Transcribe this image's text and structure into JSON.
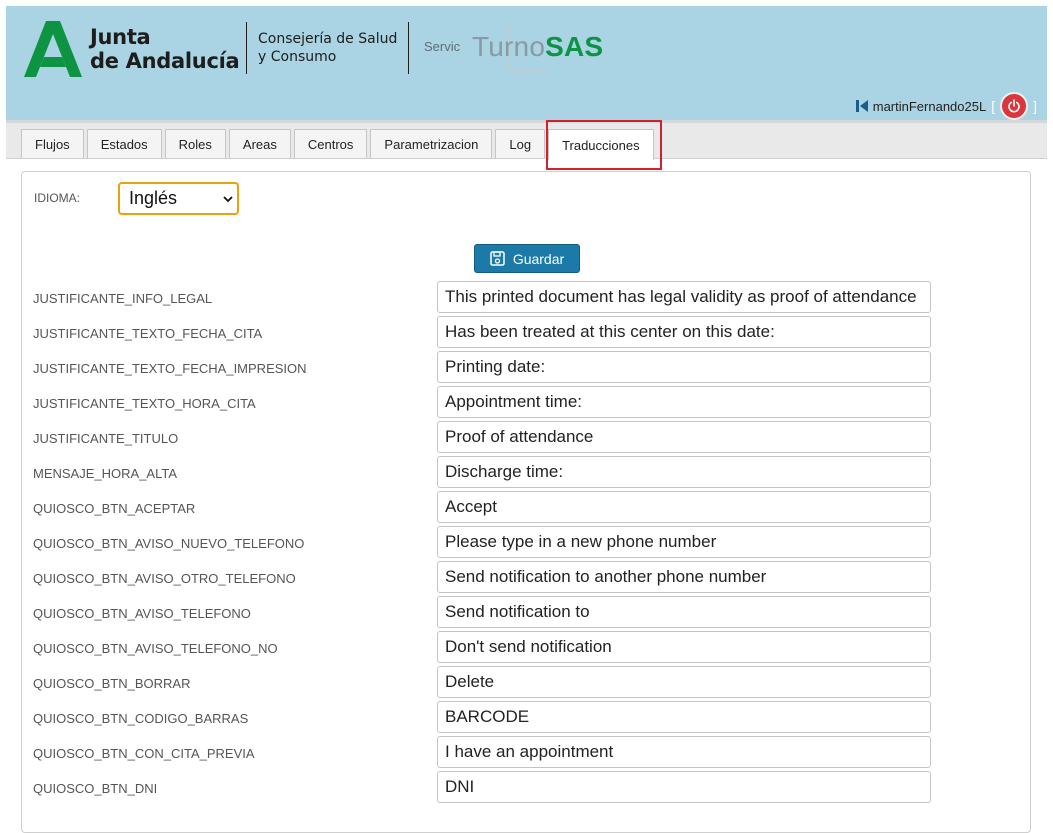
{
  "header": {
    "logo_line1": "Junta",
    "logo_line2": "de Andalucía",
    "consejeria_line1": "Consejería de Salud",
    "consejeria_line2": "y Consumo",
    "service_label": "Servic",
    "product_name_prefix": "Turno",
    "product_name_suffix": "SAS",
    "username": "martinFernando25L",
    "bracket_open": "[",
    "bracket_close": "]",
    "colors": {
      "header_bg": "#aad3e3",
      "brand_green": "#0c9443",
      "power_red": "#d9363e"
    }
  },
  "tabs": [
    {
      "label": "Flujos"
    },
    {
      "label": "Estados"
    },
    {
      "label": "Roles"
    },
    {
      "label": "Areas"
    },
    {
      "label": "Centros"
    },
    {
      "label": "Parametrizacion"
    },
    {
      "label": "Log"
    },
    {
      "label": "Traducciones",
      "active": true
    }
  ],
  "form": {
    "idioma_label": "IDIOMA:",
    "idioma_value": "Inglés",
    "save_label": "Guardar",
    "rows": [
      {
        "key": "JUSTIFICANTE_INFO_LEGAL",
        "value": "This printed document has legal validity as proof of attendance"
      },
      {
        "key": "JUSTIFICANTE_TEXTO_FECHA_CITA",
        "value": "Has been treated at this center on this date:"
      },
      {
        "key": "JUSTIFICANTE_TEXTO_FECHA_IMPRESION",
        "value": "Printing date:"
      },
      {
        "key": "JUSTIFICANTE_TEXTO_HORA_CITA",
        "value": "Appointment time:"
      },
      {
        "key": "JUSTIFICANTE_TITULO",
        "value": "Proof of attendance"
      },
      {
        "key": "MENSAJE_HORA_ALTA",
        "value": "Discharge time:"
      },
      {
        "key": "QUIOSCO_BTN_ACEPTAR",
        "value": "Accept"
      },
      {
        "key": "QUIOSCO_BTN_AVISO_NUEVO_TELEFONO",
        "value": "Please type in a new phone number"
      },
      {
        "key": "QUIOSCO_BTN_AVISO_OTRO_TELEFONO",
        "value": "Send notification to another phone number"
      },
      {
        "key": "QUIOSCO_BTN_AVISO_TELEFONO",
        "value": "Send notification to"
      },
      {
        "key": "QUIOSCO_BTN_AVISO_TELEFONO_NO",
        "value": "Don't send notification"
      },
      {
        "key": "QUIOSCO_BTN_BORRAR",
        "value": "Delete"
      },
      {
        "key": "QUIOSCO_BTN_CODIGO_BARRAS",
        "value": "BARCODE"
      },
      {
        "key": "QUIOSCO_BTN_CON_CITA_PREVIA",
        "value": "I have an appointment"
      },
      {
        "key": "QUIOSCO_BTN_DNI",
        "value": "DNI"
      }
    ]
  },
  "icons": {
    "logo": "junta-andalucia-logo-icon",
    "user": "user-skip-icon",
    "power": "power-icon",
    "save": "floppy-disk-icon",
    "select": "chevron-down-icon"
  }
}
